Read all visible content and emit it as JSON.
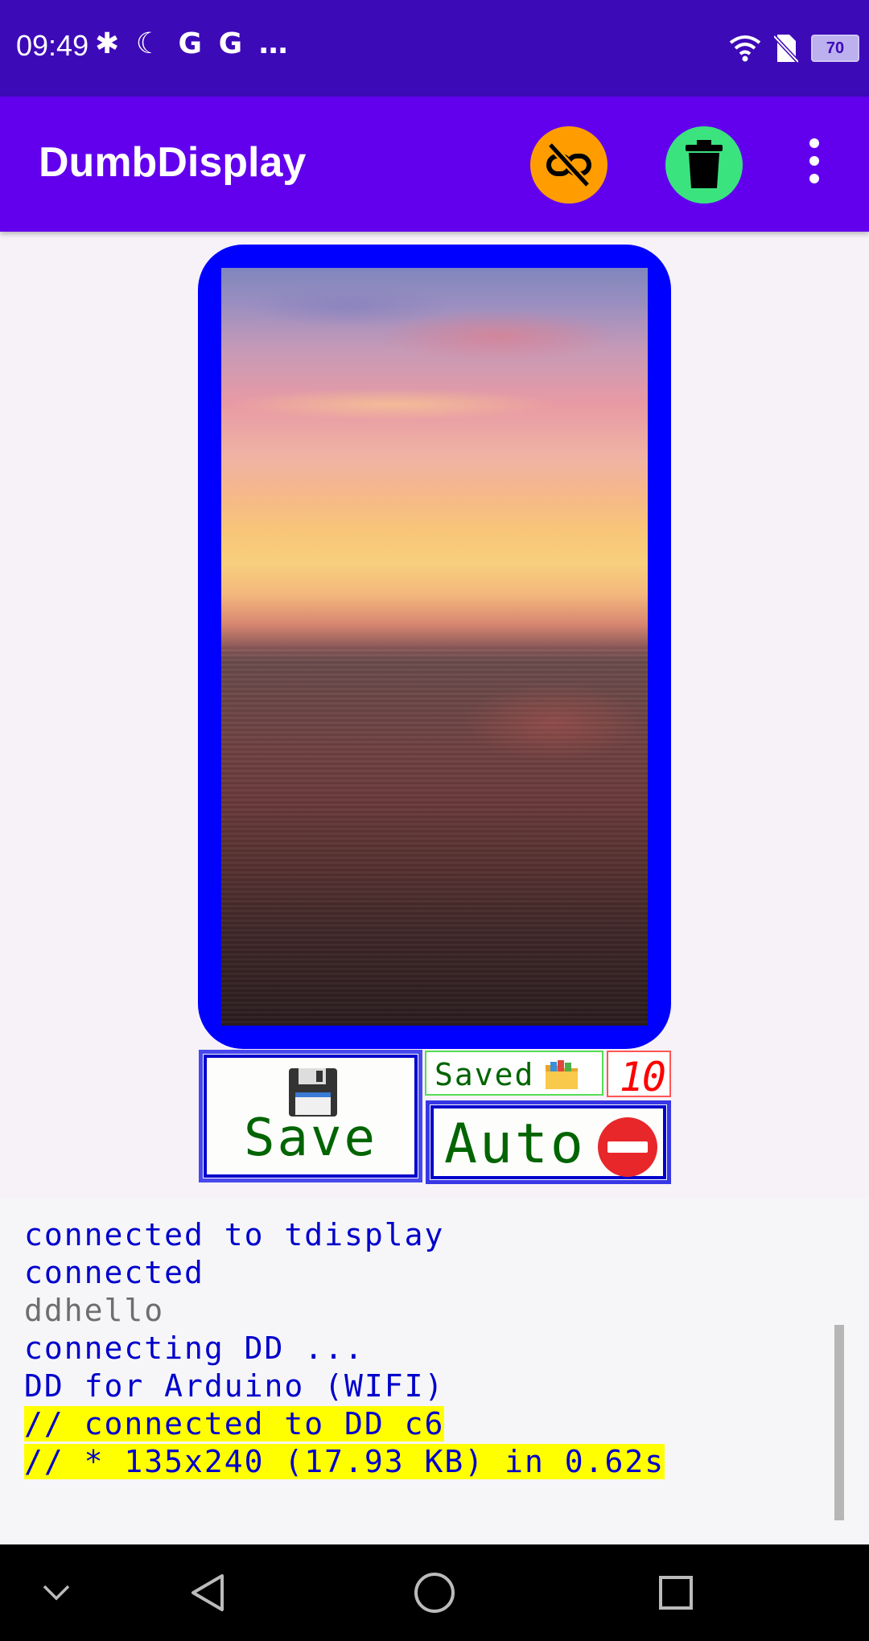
{
  "status_bar": {
    "time": "09:49",
    "left_icons": "✱ ☾ G G …",
    "battery_level": "70",
    "icons": [
      "bluetooth-icon",
      "do-not-disturb-icon",
      "google-icon",
      "google-icon",
      "more-notifications-icon",
      "wifi-icon",
      "no-sim-icon",
      "battery-icon"
    ]
  },
  "app_bar": {
    "title": "DumbDisplay",
    "actions": [
      "disconnect-link-icon",
      "trash-icon",
      "overflow-menu-icon"
    ],
    "colors": {
      "background": "#6200ee",
      "link_button": "#ff9d00",
      "trash_button": "#3be37f"
    }
  },
  "display": {
    "frame_color": "#0000ff",
    "image_description_icon": "sunset-photo"
  },
  "controls": {
    "save_button": {
      "label": "Save",
      "icon": "floppy-disk-icon"
    },
    "saved_status": {
      "label": "Saved",
      "icon": "folder-icon"
    },
    "counter": {
      "value": "10"
    },
    "auto_button": {
      "label": "Auto",
      "icon": "no-entry-icon"
    }
  },
  "log": {
    "lines": [
      {
        "text": "connected to tdisplay",
        "style": "normal"
      },
      {
        "text": "connected",
        "style": "normal"
      },
      {
        "text": "ddhello",
        "style": "gray"
      },
      {
        "text": "connecting DD ...",
        "style": "normal"
      },
      {
        "text": "DD for Arduino (WIFI)",
        "style": "normal"
      },
      {
        "text": "// connected to DD c6",
        "style": "highlight"
      },
      {
        "text": "// * 135x240 (17.93 KB) in 0.62s",
        "style": "highlight"
      }
    ]
  },
  "nav_bar": {
    "items": [
      "chevron-down-icon",
      "back-icon",
      "home-icon",
      "recents-icon"
    ]
  }
}
